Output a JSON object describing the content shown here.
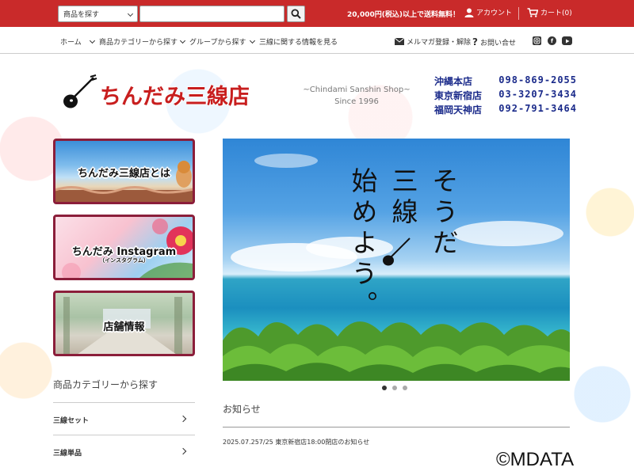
{
  "topbar": {
    "search_category": "商品を探す",
    "search_value": "",
    "notice": "20,000円(税込)以上で送料無料！",
    "account_label": "アカウント",
    "cart_label": "カート(0)"
  },
  "nav": {
    "items": [
      "ホーム",
      "商品カテゴリーから探す",
      "グループから探す",
      "三線に関する情報を見る"
    ],
    "newsletter": "メルマガ登録・解除",
    "contact": "お問い合せ",
    "social_icons": [
      "instagram-icon",
      "facebook-icon",
      "youtube-icon"
    ]
  },
  "header": {
    "logo_text": "ちんだみ三線店",
    "tagline_line1": "~Chindami Sanshin Shop~",
    "tagline_line2": "Since 1996",
    "shops": [
      {
        "name": "沖縄本店",
        "tel": "098-869-2055"
      },
      {
        "name": "東京新宿店",
        "tel": "03-3207-3434"
      },
      {
        "name": "福岡天神店",
        "tel": "092-791-3464"
      }
    ]
  },
  "banners": [
    {
      "label": "ちんだみ三線店とは"
    },
    {
      "label": "ちんだみ Instagram",
      "sub": "（インスタグラム）"
    },
    {
      "label": "店舗情報"
    }
  ],
  "categories": {
    "title": "商品カテゴリーから探す",
    "items": [
      "三線セット",
      "三線単品"
    ]
  },
  "hero": {
    "col1": "そうだ",
    "col2": "三線",
    "col3": "始めよう。",
    "slide_count": 3,
    "active_slide": 1
  },
  "news": {
    "title": "お知らせ",
    "items": [
      {
        "text": "2025.07.257/25 東京新宿店18:00閉店のお知らせ"
      }
    ]
  },
  "watermark": "©MDATA",
  "colors": {
    "brand_red": "#c92a2a",
    "banner_border": "#8b1e3a",
    "phone_blue": "#1a2a8a"
  }
}
